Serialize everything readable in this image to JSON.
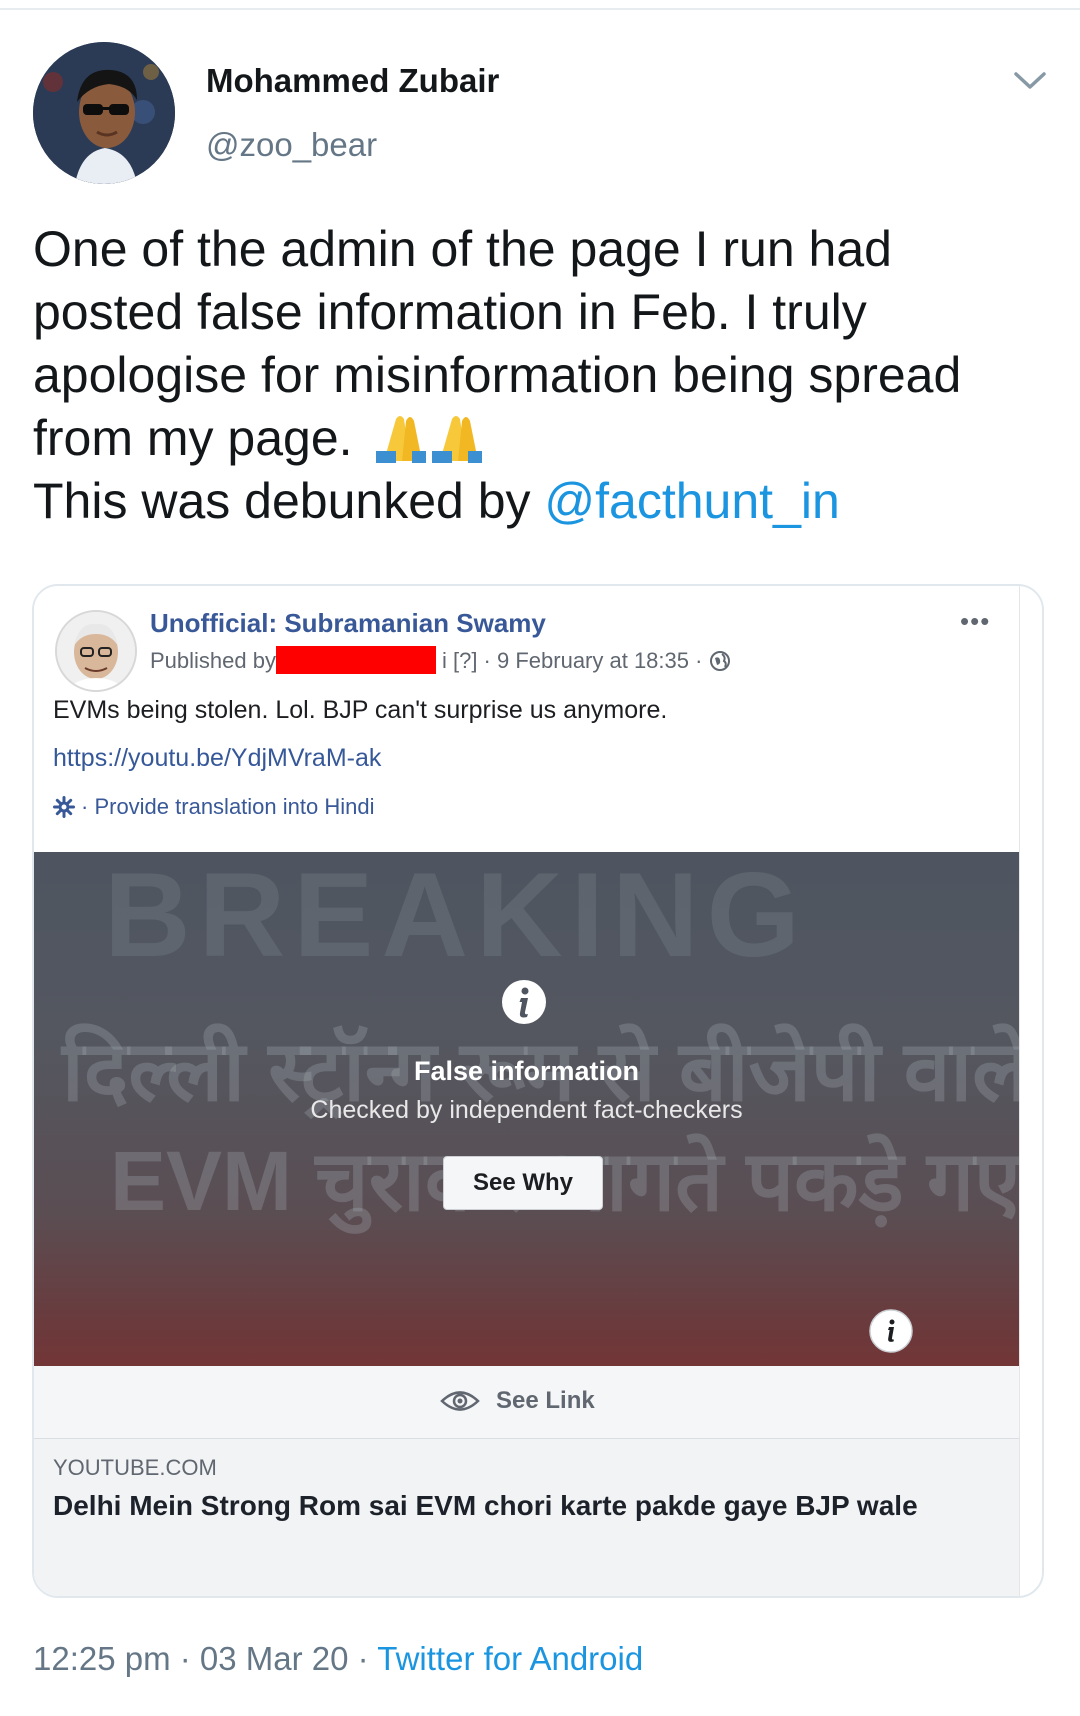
{
  "tweet": {
    "author_name": "Mohammed Zubair",
    "author_handle": "@zoo_bear",
    "text_lines": [
      "One of the admin of the page I run had",
      "posted false information in Feb. I truly",
      "apologise for misinformation being spread",
      "from my page."
    ],
    "emoji": "folded-hands x2",
    "debunk_prefix": "This was debunked by ",
    "debunk_mention": "@facthunt_in",
    "time": "12:25 pm",
    "date": "03 Mar 20",
    "source": "Twitter for Android",
    "separator": " · "
  },
  "embed": {
    "page_name": "Unofficial: Subramanian Swamy",
    "published_by": "Published by",
    "meta_suffix": "i [?] · 9 February at 18:35 · ",
    "more_dots": "•••",
    "post_text": "EVMs being stolen. Lol. BJP can't surprise us anymore.",
    "link": "https://youtu.be/YdjMVraM-ak",
    "translate": "· Provide translation into Hindi",
    "overlay_bg_lines": [
      "BREAKING",
      "दिल्ली स्ट्रॉन्ग रूम से बीजेपी वाले",
      "EVM चुराकर भागते पकड़े गए"
    ],
    "overlay_title": "False information",
    "overlay_sub": "Checked by independent fact-checkers",
    "see_why": "See Why",
    "see_link": "See Link",
    "preview_domain": "YOUTUBE.COM",
    "preview_title": "Delhi Mein Strong Rom sai EVM chori karte pakde gaye BJP wale"
  },
  "colors": {
    "link_blue": "#1b95e0",
    "fb_blue": "#385898",
    "muted": "#657786",
    "redaction": "#ff0000"
  }
}
